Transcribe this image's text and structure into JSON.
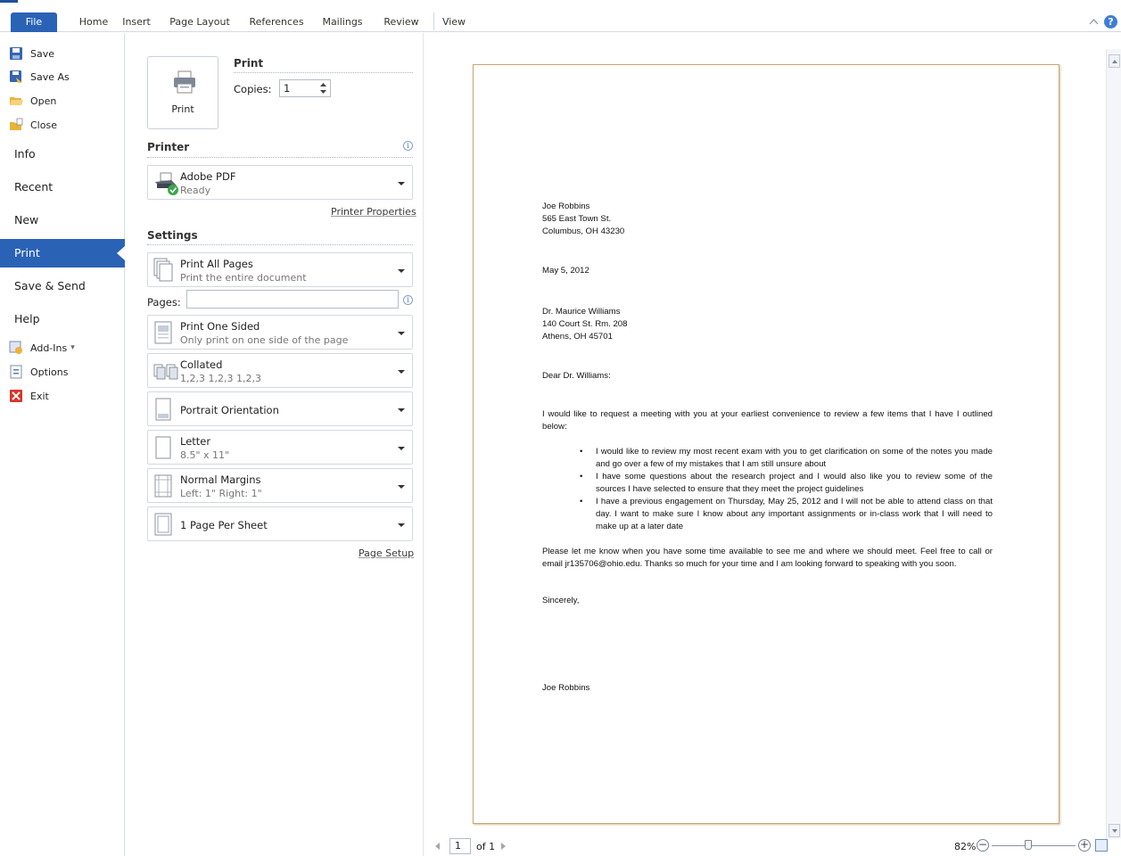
{
  "ribbon": {
    "tabs": [
      "File",
      "Home",
      "Insert",
      "Page Layout",
      "References",
      "Mailings",
      "Review",
      "View"
    ],
    "help_symbol": "?"
  },
  "nav": {
    "save": "Save",
    "save_as": "Save As",
    "open": "Open",
    "close": "Close",
    "info": "Info",
    "recent": "Recent",
    "new": "New",
    "print": "Print",
    "save_send": "Save & Send",
    "help": "Help",
    "add_ins": "Add-Ins",
    "add_ins_arrow": "▾",
    "options": "Options",
    "exit": "Exit",
    "active": "Print"
  },
  "print": {
    "section_title": "Print",
    "button_label": "Print",
    "copies_label": "Copies:",
    "copies_value": "1"
  },
  "printer": {
    "section_title": "Printer",
    "info_symbol": "i",
    "name": "Adobe PDF",
    "status": "Ready",
    "properties_link": "Printer Properties"
  },
  "settings": {
    "section_title": "Settings",
    "pages_label": "Pages:",
    "pages_value": "",
    "items": [
      {
        "title": "Print All Pages",
        "subtitle": "Print the entire document"
      },
      {
        "title": "Print One Sided",
        "subtitle": "Only print on one side of the page"
      },
      {
        "title": "Collated",
        "subtitle": "1,2,3   1,2,3   1,2,3"
      },
      {
        "title": "Portrait Orientation",
        "subtitle": ""
      },
      {
        "title": "Letter",
        "subtitle": "8.5\" x 11\""
      },
      {
        "title": "Normal Margins",
        "subtitle": "Left:  1\"   Right:  1\""
      },
      {
        "title": "1 Page Per Sheet",
        "subtitle": ""
      }
    ],
    "page_setup_link": "Page Setup"
  },
  "preview": {
    "letter": {
      "sender_name": "Joe Robbins",
      "sender_street": "565 East Town St.",
      "sender_city": "Columbus, OH 43230",
      "date": "May 5, 2012",
      "recipient_name": "Dr. Maurice Williams",
      "recipient_street": "140 Court St. Rm. 208",
      "recipient_city": "Athens, OH 45701",
      "salutation": "Dear Dr. Williams:",
      "intro": "I would like to request a meeting with you at your earliest convenience to review a few items that I have I outlined below:",
      "bullets": [
        "I would like to review my most recent exam with you to get clarification on some of the notes you made and go over a few of my mistakes that I am still unsure about",
        "I have some questions about the research project and I would also like you to review some of the sources I have selected to ensure that they meet the project guidelines",
        "I have a previous engagement on Thursday, May 25, 2012 and I will not be able to attend class on that day.  I want to make sure I know about any important assignments or in-class work that I will need to make up at a later date"
      ],
      "closing_paragraph": "Please let me know when you have some time available to see me and where we should meet. Feel free to call or email jr135706@ohio.edu.  Thanks so much for your time and I am looking forward to speaking with you soon.",
      "signoff": "Sincerely,",
      "signature": "Joe Robbins"
    },
    "page_current": "1",
    "page_of": "of 1",
    "zoom": "82%",
    "zoom_level_percent": 82,
    "zoom_minus": "−",
    "zoom_plus": "+"
  },
  "colors": {
    "accent": "#2a62b6",
    "page_border": "#c8a574"
  }
}
